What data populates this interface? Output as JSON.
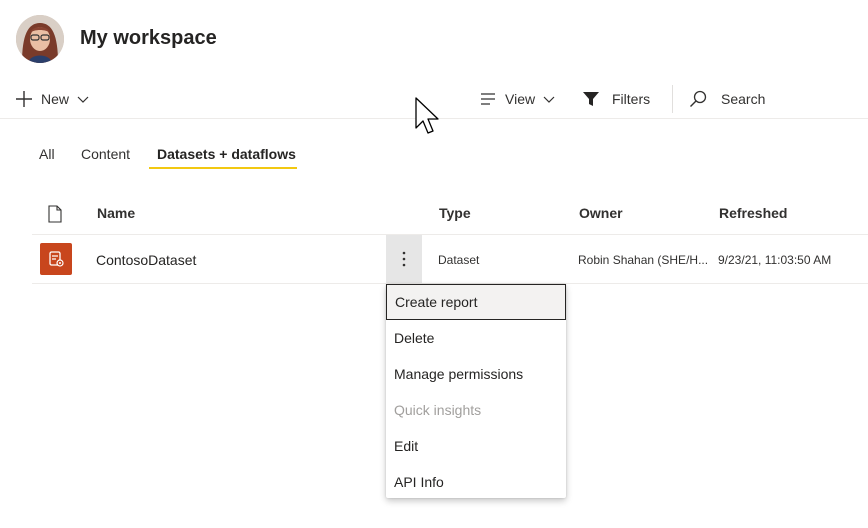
{
  "header": {
    "title": "My workspace"
  },
  "toolbar": {
    "new_label": "New",
    "view_label": "View",
    "filters_label": "Filters",
    "search_label": "Search"
  },
  "tabs": [
    {
      "label": "All",
      "active": false
    },
    {
      "label": "Content",
      "active": false
    },
    {
      "label": "Datasets + dataflows",
      "active": true
    }
  ],
  "table": {
    "columns": [
      "Name",
      "Type",
      "Owner",
      "Refreshed"
    ],
    "rows": [
      {
        "name": "ContosoDataset",
        "type": "Dataset",
        "owner": "Robin Shahan (SHE/H...",
        "refreshed": "9/23/21, 11:03:50 AM"
      }
    ]
  },
  "context_menu": {
    "items": [
      {
        "label": "Create report",
        "state": "focused"
      },
      {
        "label": "Delete",
        "state": "normal"
      },
      {
        "label": "Manage permissions",
        "state": "normal"
      },
      {
        "label": "Quick insights",
        "state": "disabled"
      },
      {
        "label": "Edit",
        "state": "normal"
      },
      {
        "label": "API Info",
        "state": "normal"
      }
    ]
  },
  "colors": {
    "tab_underline": "#f2c811",
    "dataset_icon_bg": "#c8461d"
  },
  "icons": [
    "avatar",
    "plus-icon",
    "chevron-down-icon",
    "view-lines-icon",
    "filter-funnel-icon",
    "search-icon",
    "file-icon",
    "dataset-icon",
    "more-options-icon",
    "mouse-cursor"
  ]
}
